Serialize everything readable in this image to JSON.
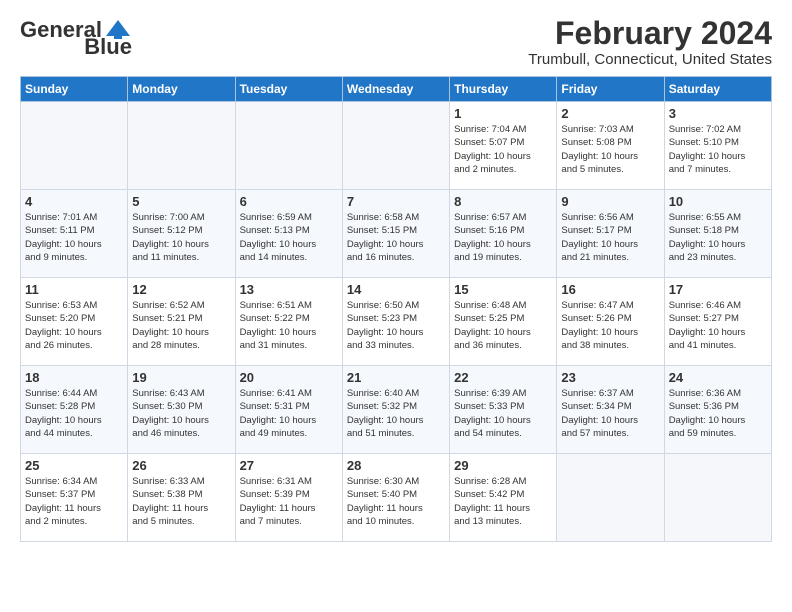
{
  "logo": {
    "text_general": "General",
    "text_blue": "Blue"
  },
  "title": "February 2024",
  "subtitle": "Trumbull, Connecticut, United States",
  "days_of_week": [
    "Sunday",
    "Monday",
    "Tuesday",
    "Wednesday",
    "Thursday",
    "Friday",
    "Saturday"
  ],
  "weeks": [
    [
      {
        "day": "",
        "info": ""
      },
      {
        "day": "",
        "info": ""
      },
      {
        "day": "",
        "info": ""
      },
      {
        "day": "",
        "info": ""
      },
      {
        "day": "1",
        "info": "Sunrise: 7:04 AM\nSunset: 5:07 PM\nDaylight: 10 hours\nand 2 minutes."
      },
      {
        "day": "2",
        "info": "Sunrise: 7:03 AM\nSunset: 5:08 PM\nDaylight: 10 hours\nand 5 minutes."
      },
      {
        "day": "3",
        "info": "Sunrise: 7:02 AM\nSunset: 5:10 PM\nDaylight: 10 hours\nand 7 minutes."
      }
    ],
    [
      {
        "day": "4",
        "info": "Sunrise: 7:01 AM\nSunset: 5:11 PM\nDaylight: 10 hours\nand 9 minutes."
      },
      {
        "day": "5",
        "info": "Sunrise: 7:00 AM\nSunset: 5:12 PM\nDaylight: 10 hours\nand 11 minutes."
      },
      {
        "day": "6",
        "info": "Sunrise: 6:59 AM\nSunset: 5:13 PM\nDaylight: 10 hours\nand 14 minutes."
      },
      {
        "day": "7",
        "info": "Sunrise: 6:58 AM\nSunset: 5:15 PM\nDaylight: 10 hours\nand 16 minutes."
      },
      {
        "day": "8",
        "info": "Sunrise: 6:57 AM\nSunset: 5:16 PM\nDaylight: 10 hours\nand 19 minutes."
      },
      {
        "day": "9",
        "info": "Sunrise: 6:56 AM\nSunset: 5:17 PM\nDaylight: 10 hours\nand 21 minutes."
      },
      {
        "day": "10",
        "info": "Sunrise: 6:55 AM\nSunset: 5:18 PM\nDaylight: 10 hours\nand 23 minutes."
      }
    ],
    [
      {
        "day": "11",
        "info": "Sunrise: 6:53 AM\nSunset: 5:20 PM\nDaylight: 10 hours\nand 26 minutes."
      },
      {
        "day": "12",
        "info": "Sunrise: 6:52 AM\nSunset: 5:21 PM\nDaylight: 10 hours\nand 28 minutes."
      },
      {
        "day": "13",
        "info": "Sunrise: 6:51 AM\nSunset: 5:22 PM\nDaylight: 10 hours\nand 31 minutes."
      },
      {
        "day": "14",
        "info": "Sunrise: 6:50 AM\nSunset: 5:23 PM\nDaylight: 10 hours\nand 33 minutes."
      },
      {
        "day": "15",
        "info": "Sunrise: 6:48 AM\nSunset: 5:25 PM\nDaylight: 10 hours\nand 36 minutes."
      },
      {
        "day": "16",
        "info": "Sunrise: 6:47 AM\nSunset: 5:26 PM\nDaylight: 10 hours\nand 38 minutes."
      },
      {
        "day": "17",
        "info": "Sunrise: 6:46 AM\nSunset: 5:27 PM\nDaylight: 10 hours\nand 41 minutes."
      }
    ],
    [
      {
        "day": "18",
        "info": "Sunrise: 6:44 AM\nSunset: 5:28 PM\nDaylight: 10 hours\nand 44 minutes."
      },
      {
        "day": "19",
        "info": "Sunrise: 6:43 AM\nSunset: 5:30 PM\nDaylight: 10 hours\nand 46 minutes."
      },
      {
        "day": "20",
        "info": "Sunrise: 6:41 AM\nSunset: 5:31 PM\nDaylight: 10 hours\nand 49 minutes."
      },
      {
        "day": "21",
        "info": "Sunrise: 6:40 AM\nSunset: 5:32 PM\nDaylight: 10 hours\nand 51 minutes."
      },
      {
        "day": "22",
        "info": "Sunrise: 6:39 AM\nSunset: 5:33 PM\nDaylight: 10 hours\nand 54 minutes."
      },
      {
        "day": "23",
        "info": "Sunrise: 6:37 AM\nSunset: 5:34 PM\nDaylight: 10 hours\nand 57 minutes."
      },
      {
        "day": "24",
        "info": "Sunrise: 6:36 AM\nSunset: 5:36 PM\nDaylight: 10 hours\nand 59 minutes."
      }
    ],
    [
      {
        "day": "25",
        "info": "Sunrise: 6:34 AM\nSunset: 5:37 PM\nDaylight: 11 hours\nand 2 minutes."
      },
      {
        "day": "26",
        "info": "Sunrise: 6:33 AM\nSunset: 5:38 PM\nDaylight: 11 hours\nand 5 minutes."
      },
      {
        "day": "27",
        "info": "Sunrise: 6:31 AM\nSunset: 5:39 PM\nDaylight: 11 hours\nand 7 minutes."
      },
      {
        "day": "28",
        "info": "Sunrise: 6:30 AM\nSunset: 5:40 PM\nDaylight: 11 hours\nand 10 minutes."
      },
      {
        "day": "29",
        "info": "Sunrise: 6:28 AM\nSunset: 5:42 PM\nDaylight: 11 hours\nand 13 minutes."
      },
      {
        "day": "",
        "info": ""
      },
      {
        "day": "",
        "info": ""
      }
    ]
  ]
}
